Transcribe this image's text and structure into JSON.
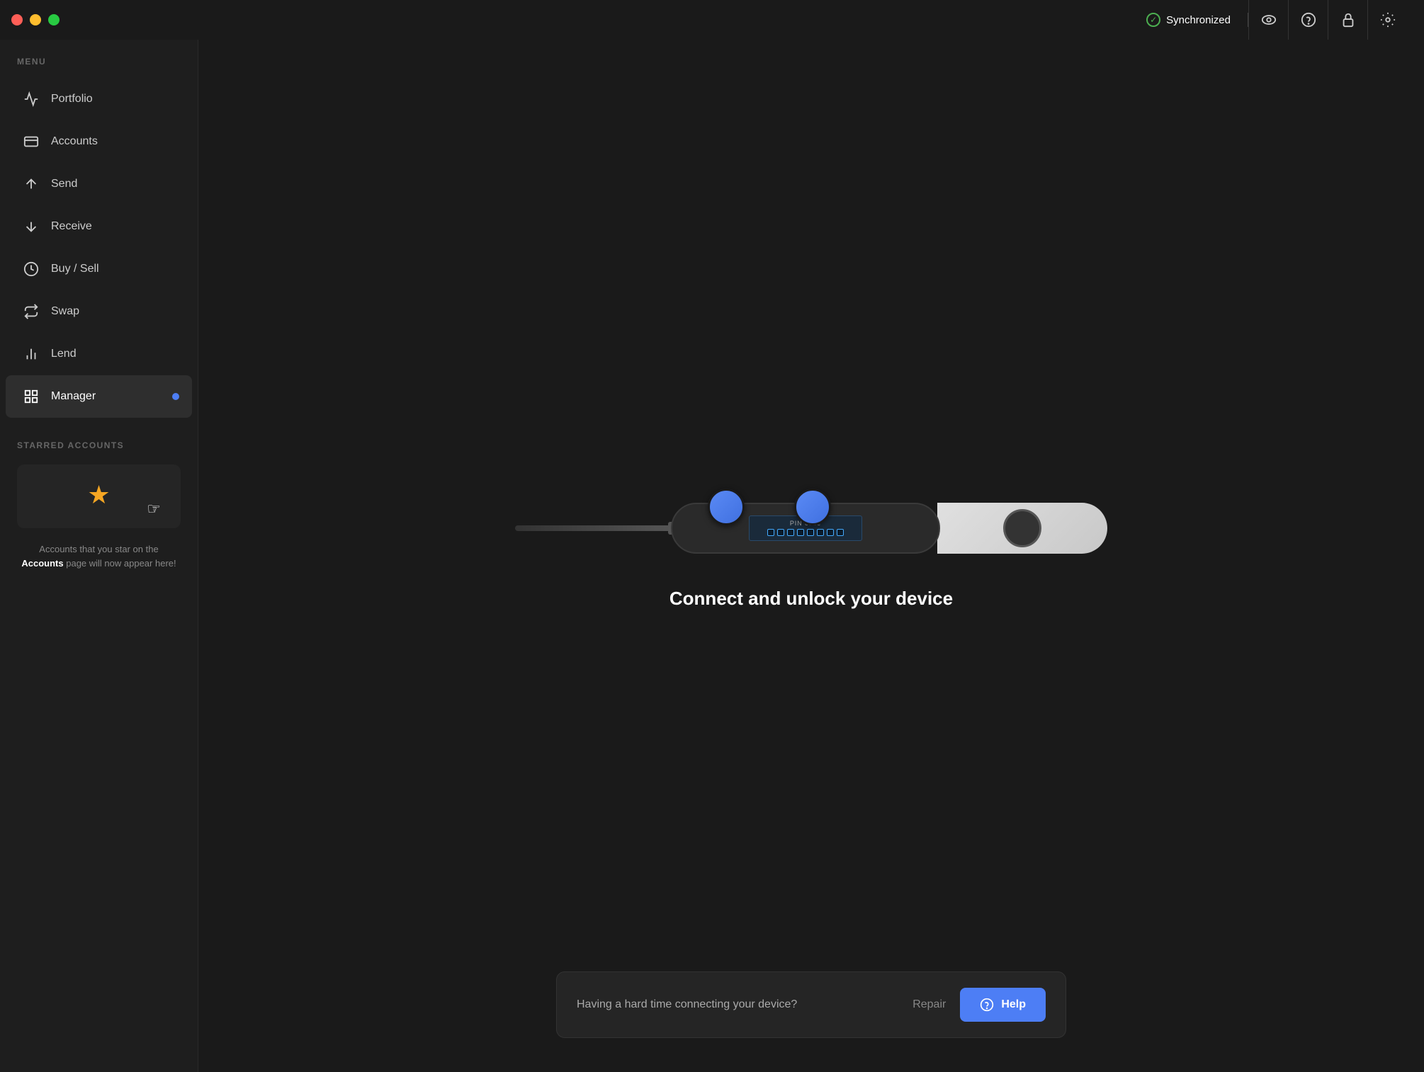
{
  "titlebar": {
    "sync_label": "Synchronized",
    "sync_color": "#4caf50"
  },
  "sidebar": {
    "menu_label": "MENU",
    "nav_items": [
      {
        "id": "portfolio",
        "label": "Portfolio",
        "active": false
      },
      {
        "id": "accounts",
        "label": "Accounts",
        "active": false
      },
      {
        "id": "send",
        "label": "Send",
        "active": false
      },
      {
        "id": "receive",
        "label": "Receive",
        "active": false
      },
      {
        "id": "buy-sell",
        "label": "Buy / Sell",
        "active": false
      },
      {
        "id": "swap",
        "label": "Swap",
        "active": false
      },
      {
        "id": "lend",
        "label": "Lend",
        "active": false
      },
      {
        "id": "manager",
        "label": "Manager",
        "active": true
      }
    ],
    "starred_label": "STARRED ACCOUNTS",
    "starred_description_1": "Accounts that you star on the",
    "starred_highlight": "Accounts",
    "starred_description_2": "page will now appear here!"
  },
  "main": {
    "connect_title": "Connect and unlock your device",
    "bottom_bar": {
      "text": "Having a hard time connecting your device?",
      "repair_label": "Repair",
      "help_label": "Help"
    },
    "device": {
      "pin_label": "PIN code",
      "dots_count": 8
    }
  }
}
